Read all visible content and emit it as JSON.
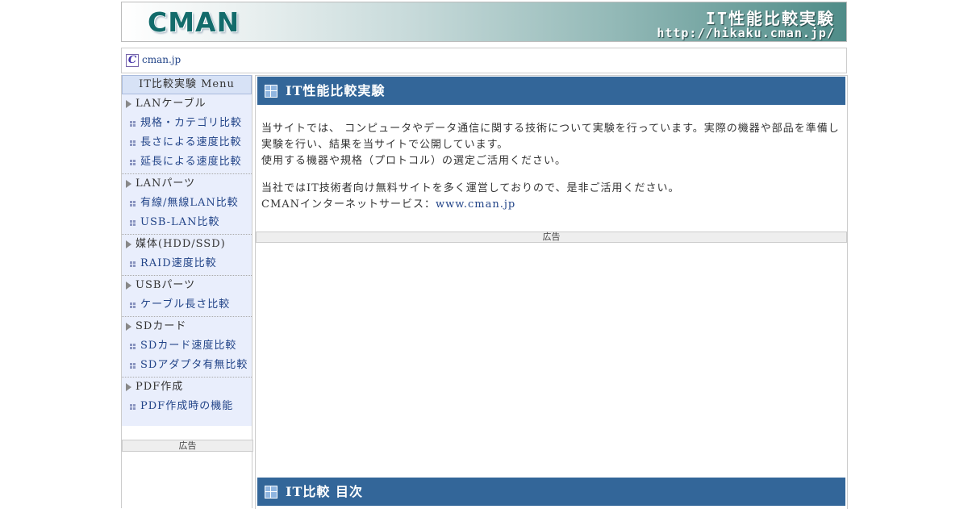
{
  "header": {
    "logo_text": "CMAN",
    "site_title": "IT性能比較実験",
    "site_url": "http://hikaku.cman.jp/"
  },
  "breadcrumb": {
    "icon_glyph": "C",
    "link_text": "cman.jp"
  },
  "sidebar": {
    "menu_title": "IT比較実験 Menu",
    "groups": [
      {
        "category": "LANケーブル",
        "items": [
          {
            "label": "規格・カテゴリ比較"
          },
          {
            "label": "長さによる速度比較"
          },
          {
            "label": "延長による速度比較"
          }
        ]
      },
      {
        "category": "LANパーツ",
        "items": [
          {
            "label": "有線/無線LAN比較"
          },
          {
            "label": "USB-LAN比較"
          }
        ]
      },
      {
        "category": "媒体(HDD/SSD)",
        "items": [
          {
            "label": "RAID速度比較"
          }
        ]
      },
      {
        "category": "USBパーツ",
        "items": [
          {
            "label": "ケーブル長さ比較"
          }
        ]
      },
      {
        "category": "SDカード",
        "items": [
          {
            "label": "SDカード速度比較"
          },
          {
            "label": "SDアダプタ有無比較"
          }
        ]
      },
      {
        "category": "PDF作成",
        "items": [
          {
            "label": "PDF作成時の機能"
          }
        ]
      }
    ],
    "ad_label": "広告"
  },
  "main": {
    "section1_title": "IT性能比較実験",
    "intro_line1": "当サイトでは、 コンピュータやデータ通信に関する技術について実験を行っています。実際の機器や部品を準備し",
    "intro_line2": "実験を行い、結果を当サイトで公開しています。",
    "intro_line3": "使用する機器や規格（プロトコル）の選定ご活用ください。",
    "service_line1": "当社ではIT技術者向け無料サイトを多く運営しておりので、是非ご活用ください。",
    "service_prefix": "CMANインターネットサービス：",
    "service_link": "www.cman.jp",
    "ad_label": "広告",
    "section2_title": "IT比較 目次"
  },
  "colors": {
    "section_header_bg": "#336699",
    "menu_bg": "#e9eefc",
    "link": "#224488"
  }
}
